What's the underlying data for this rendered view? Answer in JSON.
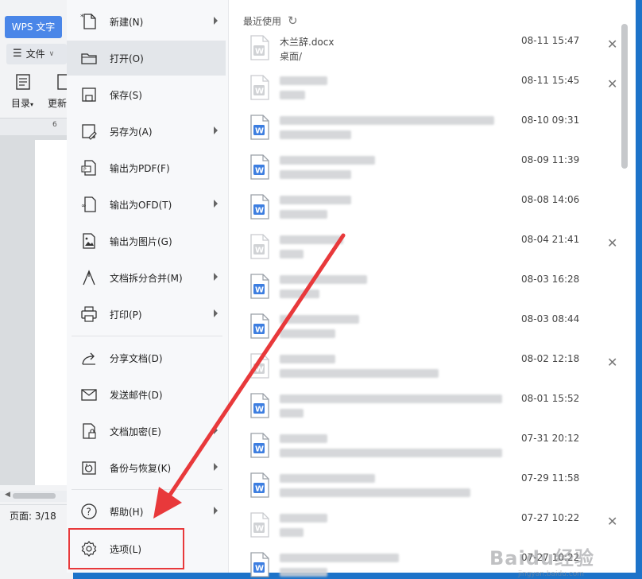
{
  "app": {
    "title_tab": "WPS 文字",
    "file_menu_label": "文件",
    "toolbar": {
      "toc_label": "目录",
      "update_label": "更新"
    },
    "ruler_mark": "6",
    "status_page": "页面: 3/18"
  },
  "menu": {
    "items": [
      {
        "label": "新建(N)",
        "icon": "new-doc-icon",
        "submenu": true
      },
      {
        "label": "打开(O)",
        "icon": "folder-icon",
        "submenu": false,
        "active": true
      },
      {
        "label": "保存(S)",
        "icon": "save-icon",
        "submenu": false
      },
      {
        "label": "另存为(A)",
        "icon": "save-as-icon",
        "submenu": true
      },
      {
        "label": "输出为PDF(F)",
        "icon": "pdf-icon",
        "submenu": false
      },
      {
        "label": "输出为OFD(T)",
        "icon": "ofd-icon",
        "submenu": true
      },
      {
        "label": "输出为图片(G)",
        "icon": "image-icon",
        "submenu": false
      },
      {
        "label": "文档拆分合并(M)",
        "icon": "split-merge-icon",
        "submenu": true
      },
      {
        "label": "打印(P)",
        "icon": "print-icon",
        "submenu": true
      },
      {
        "label": "分享文档(D)",
        "icon": "share-icon",
        "submenu": false
      },
      {
        "label": "发送邮件(D)",
        "icon": "mail-icon",
        "submenu": false
      },
      {
        "label": "文档加密(E)",
        "icon": "encrypt-icon",
        "submenu": true
      },
      {
        "label": "备份与恢复(K)",
        "icon": "backup-icon",
        "submenu": true
      },
      {
        "label": "帮助(H)",
        "icon": "help-icon",
        "submenu": true
      },
      {
        "label": "选项(L)",
        "icon": "gear-icon",
        "submenu": false,
        "highlighted": true
      }
    ]
  },
  "recent": {
    "title": "最近使用",
    "files": [
      {
        "name": "木兰辞.docx",
        "path": "桌面/",
        "date": "08-11 15:47",
        "removable": true,
        "faded": true
      },
      {
        "name": "",
        "path": "",
        "date": "08-11 15:45",
        "removable": true,
        "faded": true
      },
      {
        "name": "",
        "path": "",
        "date": "08-10 09:31",
        "removable": false,
        "faded": false
      },
      {
        "name": "",
        "path": "",
        "date": "08-09 11:39",
        "removable": false,
        "faded": false
      },
      {
        "name": "",
        "path": "",
        "date": "08-08 14:06",
        "removable": false,
        "faded": false
      },
      {
        "name": "",
        "path": "",
        "date": "08-04 21:41",
        "removable": true,
        "faded": true
      },
      {
        "name": "",
        "path": "",
        "date": "08-03 16:28",
        "removable": false,
        "faded": false
      },
      {
        "name": "",
        "path": "",
        "date": "08-03 08:44",
        "removable": false,
        "faded": false
      },
      {
        "name": "",
        "path": "",
        "date": "08-02 12:18",
        "removable": true,
        "faded": true
      },
      {
        "name": "",
        "path": "",
        "date": "08-01 15:52",
        "removable": false,
        "faded": false
      },
      {
        "name": "",
        "path": "",
        "date": "07-31 20:12",
        "removable": false,
        "faded": false
      },
      {
        "name": "",
        "path": "",
        "date": "07-29 11:58",
        "removable": false,
        "faded": false
      },
      {
        "name": "",
        "path": "",
        "date": "07-27 10:22",
        "removable": true,
        "faded": true
      },
      {
        "name": "",
        "path": "",
        "date": "07-27 10:22",
        "removable": false,
        "faded": false
      }
    ]
  },
  "watermark": {
    "text": "Baidu经验",
    "subtext": "jingyan.baidu.com"
  },
  "colors": {
    "accent": "#4a86e8",
    "word_blue": "#3d7ee0",
    "annotation_red": "#e8393b"
  }
}
